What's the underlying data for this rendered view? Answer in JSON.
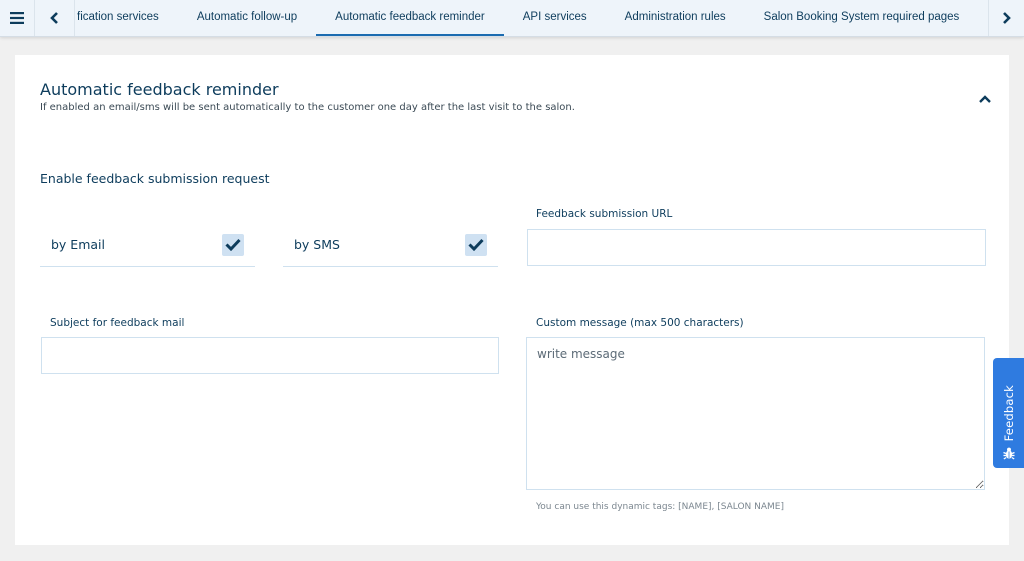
{
  "topbar": {
    "tabs": [
      {
        "label": "fication services",
        "active": false
      },
      {
        "label": "Automatic follow-up",
        "active": false
      },
      {
        "label": "Automatic feedback reminder",
        "active": true
      },
      {
        "label": "API services",
        "active": false
      },
      {
        "label": "Administration rules",
        "active": false
      },
      {
        "label": "Salon Booking System required pages",
        "active": false
      }
    ]
  },
  "card": {
    "title": "Automatic feedback reminder",
    "description": "If enabled an email/sms will be sent automatically to the customer one day after the last visit to the salon.",
    "section_title": "Enable feedback submission request",
    "by_email": {
      "label": "by Email",
      "checked": true
    },
    "by_sms": {
      "label": "by SMS",
      "checked": true
    },
    "feedback_url": {
      "label": "Feedback submission URL",
      "value": "",
      "placeholder": ""
    },
    "subject": {
      "label": "Subject for feedback mail",
      "value": "",
      "placeholder": ""
    },
    "custom_message": {
      "label": "Custom message (max 500 characters)",
      "value": "",
      "placeholder": "write message",
      "hint": "You can use this dynamic tags: [NAME], [SALON NAME]"
    }
  },
  "feedback_widget": {
    "label": "Feedback",
    "icon": "bug-icon"
  },
  "colors": {
    "accent": "#1b6bb0",
    "text": "#0d3c5c",
    "checkbox_bg": "#cfe1f2",
    "feedback_button": "#2f7be0"
  }
}
